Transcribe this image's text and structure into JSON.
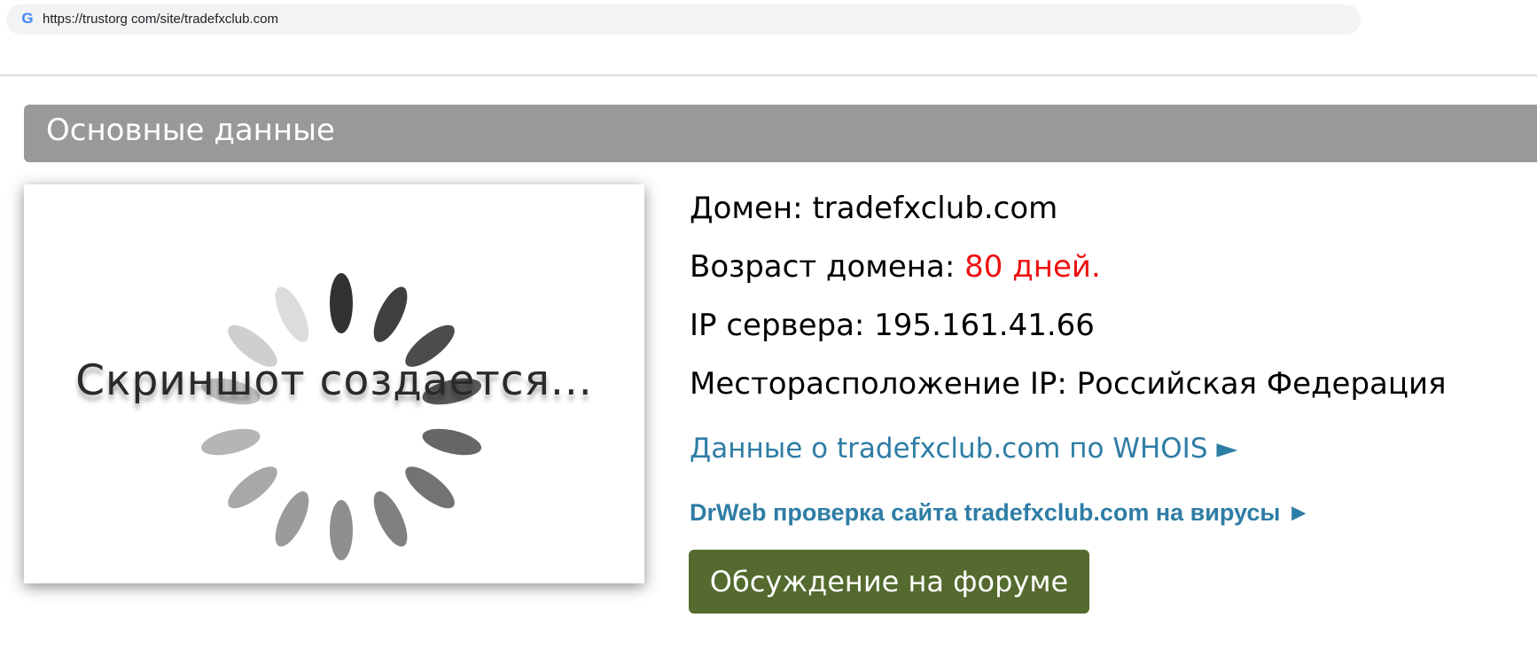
{
  "browser": {
    "url": "https://trustorg com/site/tradefxclub.com",
    "icon": "google-g-icon",
    "icon_glyph": "G"
  },
  "section": {
    "title": "Основные данные"
  },
  "screenshot_placeholder": {
    "text": "Скриншот создается...",
    "icon": "loading-spinner-icon"
  },
  "info": {
    "domain_label": "Домен:",
    "domain_value": "tradefxclub.com",
    "age_label": "Возраст домена:",
    "age_value": "80 дней.",
    "ip_label": "IP сервера:",
    "ip_value": "195.161.41.66",
    "location_label": "Месторасположение IP:",
    "location_value": "Российская Федерация"
  },
  "links": {
    "whois": "Данные о tradefxclub.com по WHOIS ►",
    "drweb": "DrWeb проверка сайта tradefxclub.com на вирусы ►"
  },
  "forum_button": {
    "label": "Обсуждение на форуме"
  },
  "colors": {
    "header_bg": "#999999",
    "link": "#2e7da5",
    "age_value": "#ee1111",
    "forum_button_bg": "#546a2e"
  }
}
